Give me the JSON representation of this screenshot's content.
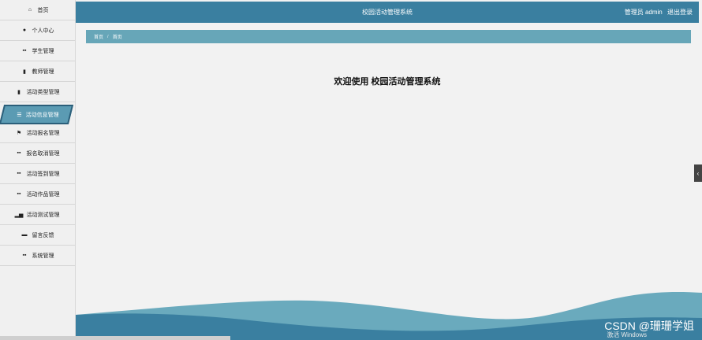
{
  "sidebar": {
    "items": [
      {
        "label": "首页",
        "icon": "home-icon"
      },
      {
        "label": "个人中心",
        "icon": "user-icon"
      },
      {
        "label": "学生管理",
        "icon": "grid-icon"
      },
      {
        "label": "教师管理",
        "icon": "clipboard-icon"
      },
      {
        "label": "活动类型管理",
        "icon": "list-icon"
      },
      {
        "label": "活动信息管理",
        "icon": "sliders-icon"
      },
      {
        "label": "活动报名管理",
        "icon": "flag-icon"
      },
      {
        "label": "报名取消管理",
        "icon": "grid-icon"
      },
      {
        "label": "活动签到管理",
        "icon": "grid-icon"
      },
      {
        "label": "活动作品管理",
        "icon": "grid-icon"
      },
      {
        "label": "活动测试管理",
        "icon": "bar-chart-icon"
      },
      {
        "label": "留言反馈",
        "icon": "briefcase-icon"
      },
      {
        "label": "系统管理",
        "icon": "grid-icon"
      }
    ],
    "active_index": 5
  },
  "header": {
    "title": "校园活动管理系统",
    "user_label": "管理员 admin",
    "logout_label": "退出登录"
  },
  "breadcrumb": {
    "first": "首页",
    "separator": "/",
    "current": "首页"
  },
  "main": {
    "welcome": "欢迎使用 校园活动管理系统"
  },
  "overlay": {
    "watermark": "CSDN @珊珊学姐",
    "activate": "激活 Windows"
  },
  "colors": {
    "header": "#3a7fa0",
    "breadcrumb": "#67a6b8",
    "active_item": "#5b9bb3"
  }
}
